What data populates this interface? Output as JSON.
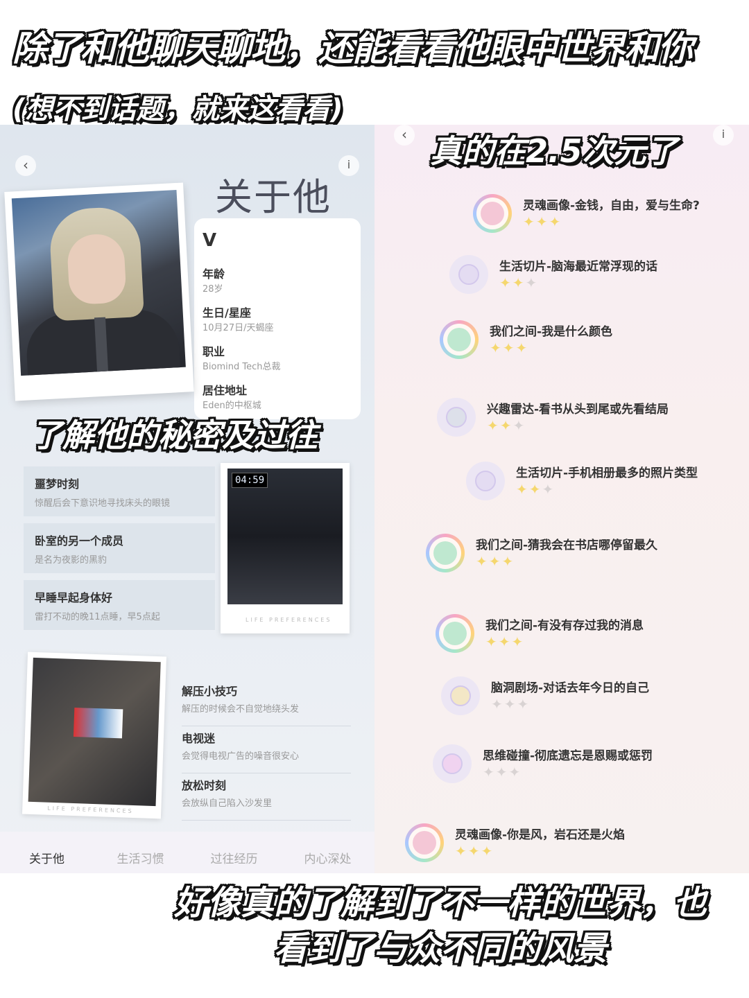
{
  "captions": {
    "top_line1": "除了和他聊天聊地，还能看看他眼中世界和你",
    "top_line2": "(想不到话题，就来这看看)",
    "right_overlay": "真的在2.5次元了",
    "left_overlay": "了解他的秘密及过往",
    "bottom_line1": "好像真的了解到了不一样的世界，也",
    "bottom_line2": "看到了与众不同的风景"
  },
  "left_panel": {
    "back_icon": "chevron-left-icon",
    "info_icon": "info-icon",
    "title": "关于他",
    "name": "V",
    "fields": [
      {
        "label": "年龄",
        "value": "28岁"
      },
      {
        "label": "生日/星座",
        "value": "10月27日/天蝎座"
      },
      {
        "label": "职业",
        "value": "Biomind Tech总裁"
      },
      {
        "label": "居住地址",
        "value": "Eden的中枢城"
      }
    ],
    "info_items": [
      {
        "title": "噩梦时刻",
        "subtitle": "惊醒后会下意识地寻找床头的眼镜"
      },
      {
        "title": "卧室的另一个成员",
        "subtitle": "是名为夜影的黑豹"
      },
      {
        "title": "早睡早起身体好",
        "subtitle": "雷打不动的晚11点睡，早5点起"
      }
    ],
    "bedroom_clock": "04:59",
    "photo_caption": "LIFE PREFERENCES",
    "lifestyle_items": [
      {
        "title": "解压小技巧",
        "subtitle": "解压的时候会不自觉地绕头发"
      },
      {
        "title": "电视迷",
        "subtitle": "会觉得电视广告的噪音很安心"
      },
      {
        "title": "放松时刻",
        "subtitle": "会放纵自己陷入沙发里"
      }
    ],
    "tabs": [
      "关于他",
      "生活习惯",
      "过往经历",
      "内心深处"
    ],
    "active_tab": 0
  },
  "right_panel": {
    "topics": [
      {
        "title": "灵魂画像-金钱，自由，爱与生命?",
        "stars": 3,
        "style": "ring",
        "core": "#f4c7d6"
      },
      {
        "title": "生活切片-脑海最近常浮现的话",
        "stars": 2,
        "style": "plain",
        "core": "#e4dcf2"
      },
      {
        "title": "我们之间-我是什么颜色",
        "stars": 3,
        "style": "ring",
        "core": "#bfe8d0"
      },
      {
        "title": "兴趣雷达-看书从头到尾或先看结局",
        "stars": 2,
        "style": "plain",
        "core": "#dde0ea"
      },
      {
        "title": "生活切片-手机相册最多的照片类型",
        "stars": 2,
        "style": "plain",
        "core": "#e4dcf2"
      },
      {
        "title": "我们之间-猜我会在书店哪停留最久",
        "stars": 3,
        "style": "ring",
        "core": "#bfe8d0"
      },
      {
        "title": "我们之间-有没有存过我的消息",
        "stars": 3,
        "style": "ring",
        "core": "#bfe8d0"
      },
      {
        "title": "脑洞剧场-对话去年今日的自己",
        "stars": 0,
        "style": "plain",
        "core": "#f3e7c6"
      },
      {
        "title": "思维碰撞-彻底遗忘是恩赐或惩罚",
        "stars": 0,
        "style": "plain",
        "core": "#f0d3f0"
      },
      {
        "title": "灵魂画像-你是风，岩石还是火焰",
        "stars": 3,
        "style": "ring",
        "core": "#f4c7d6"
      }
    ]
  }
}
